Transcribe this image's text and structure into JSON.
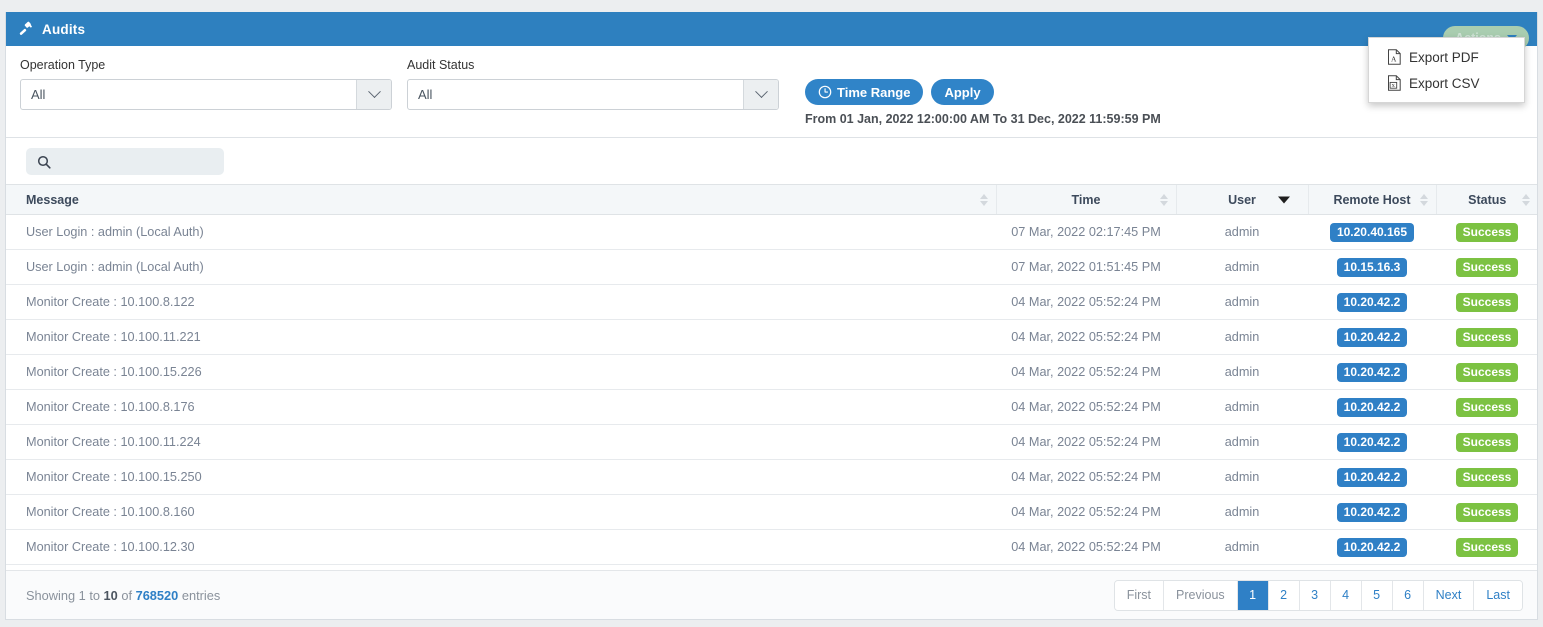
{
  "header": {
    "title": "Audits",
    "icon": "gavel-icon",
    "actions_label": "Actions",
    "accent_blue": "#2e80bf",
    "actions_bg": "#a9cdb0"
  },
  "dropdown": {
    "items": [
      {
        "label": "Export PDF",
        "icon": "pdf-file-icon"
      },
      {
        "label": "Export CSV",
        "icon": "csv-file-icon"
      }
    ]
  },
  "filters": {
    "operation_type": {
      "label": "Operation Type",
      "value": "All"
    },
    "audit_status": {
      "label": "Audit Status",
      "value": "All"
    },
    "time_range_button": "Time Range",
    "apply_button": "Apply",
    "range_text": "From 01 Jan, 2022 12:00:00 AM To 31 Dec, 2022 11:59:59 PM"
  },
  "search": {
    "value": "",
    "placeholder": ""
  },
  "table": {
    "columns": [
      {
        "label": "Message",
        "sort": "none"
      },
      {
        "label": "Time",
        "sort": "none"
      },
      {
        "label": "User",
        "sort": "desc"
      },
      {
        "label": "Remote Host",
        "sort": "none"
      },
      {
        "label": "Status",
        "sort": "none"
      }
    ],
    "rows": [
      {
        "message": "User Login : admin (Local Auth)",
        "time": "07 Mar, 2022 02:17:45 PM",
        "user": "admin",
        "host": "10.20.40.165",
        "status": "Success"
      },
      {
        "message": "User Login : admin (Local Auth)",
        "time": "07 Mar, 2022 01:51:45 PM",
        "user": "admin",
        "host": "10.15.16.3",
        "status": "Success"
      },
      {
        "message": "Monitor Create : 10.100.8.122",
        "time": "04 Mar, 2022 05:52:24 PM",
        "user": "admin",
        "host": "10.20.42.2",
        "status": "Success"
      },
      {
        "message": "Monitor Create : 10.100.11.221",
        "time": "04 Mar, 2022 05:52:24 PM",
        "user": "admin",
        "host": "10.20.42.2",
        "status": "Success"
      },
      {
        "message": "Monitor Create : 10.100.15.226",
        "time": "04 Mar, 2022 05:52:24 PM",
        "user": "admin",
        "host": "10.20.42.2",
        "status": "Success"
      },
      {
        "message": "Monitor Create : 10.100.8.176",
        "time": "04 Mar, 2022 05:52:24 PM",
        "user": "admin",
        "host": "10.20.42.2",
        "status": "Success"
      },
      {
        "message": "Monitor Create : 10.100.11.224",
        "time": "04 Mar, 2022 05:52:24 PM",
        "user": "admin",
        "host": "10.20.42.2",
        "status": "Success"
      },
      {
        "message": "Monitor Create : 10.100.15.250",
        "time": "04 Mar, 2022 05:52:24 PM",
        "user": "admin",
        "host": "10.20.42.2",
        "status": "Success"
      },
      {
        "message": "Monitor Create : 10.100.8.160",
        "time": "04 Mar, 2022 05:52:24 PM",
        "user": "admin",
        "host": "10.20.42.2",
        "status": "Success"
      },
      {
        "message": "Monitor Create : 10.100.12.30",
        "time": "04 Mar, 2022 05:52:24 PM",
        "user": "admin",
        "host": "10.20.42.2",
        "status": "Success"
      }
    ]
  },
  "footer": {
    "showing_prefix": "Showing 1 to ",
    "showing_count": "10",
    "showing_mid": " of ",
    "showing_total": "768520",
    "showing_suffix": " entries",
    "pagination": [
      {
        "label": "First",
        "type": "nav",
        "state": "disabled"
      },
      {
        "label": "Previous",
        "type": "nav",
        "state": "disabled"
      },
      {
        "label": "1",
        "type": "num",
        "state": "active"
      },
      {
        "label": "2",
        "type": "num",
        "state": "normal"
      },
      {
        "label": "3",
        "type": "num",
        "state": "normal"
      },
      {
        "label": "4",
        "type": "num",
        "state": "normal"
      },
      {
        "label": "5",
        "type": "num",
        "state": "normal"
      },
      {
        "label": "6",
        "type": "num",
        "state": "normal"
      },
      {
        "label": "Next",
        "type": "nav",
        "state": "normal"
      },
      {
        "label": "Last",
        "type": "nav",
        "state": "normal"
      }
    ]
  }
}
